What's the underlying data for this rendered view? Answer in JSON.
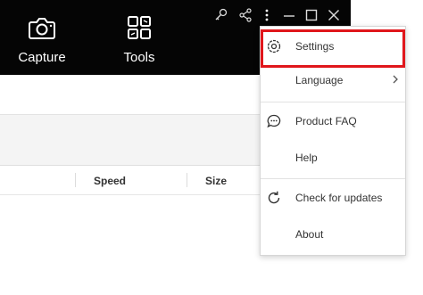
{
  "app": {
    "nav": [
      {
        "label": "Capture",
        "icon": "camera-icon"
      },
      {
        "label": "Tools",
        "icon": "tools-grid-icon"
      }
    ],
    "titlebar_buttons": [
      "key-icon",
      "share-icon",
      "more-vertical-icon",
      "minimize-icon",
      "maximize-icon",
      "close-icon"
    ],
    "table": {
      "columns": [
        "Speed",
        "Size"
      ]
    },
    "colors": {
      "titlebar_bg": "#050505",
      "highlight": "#e0161b"
    }
  },
  "menu": {
    "items": [
      {
        "label": "Settings",
        "icon": "gear-icon",
        "highlighted": true
      },
      {
        "label": "Language",
        "icon": "",
        "submenu": true
      },
      {
        "label": "Product FAQ",
        "icon": "chat-bubble-icon"
      },
      {
        "label": "Help",
        "icon": ""
      },
      {
        "label": "Check for updates",
        "icon": "refresh-icon"
      },
      {
        "label": "About",
        "icon": ""
      }
    ]
  }
}
